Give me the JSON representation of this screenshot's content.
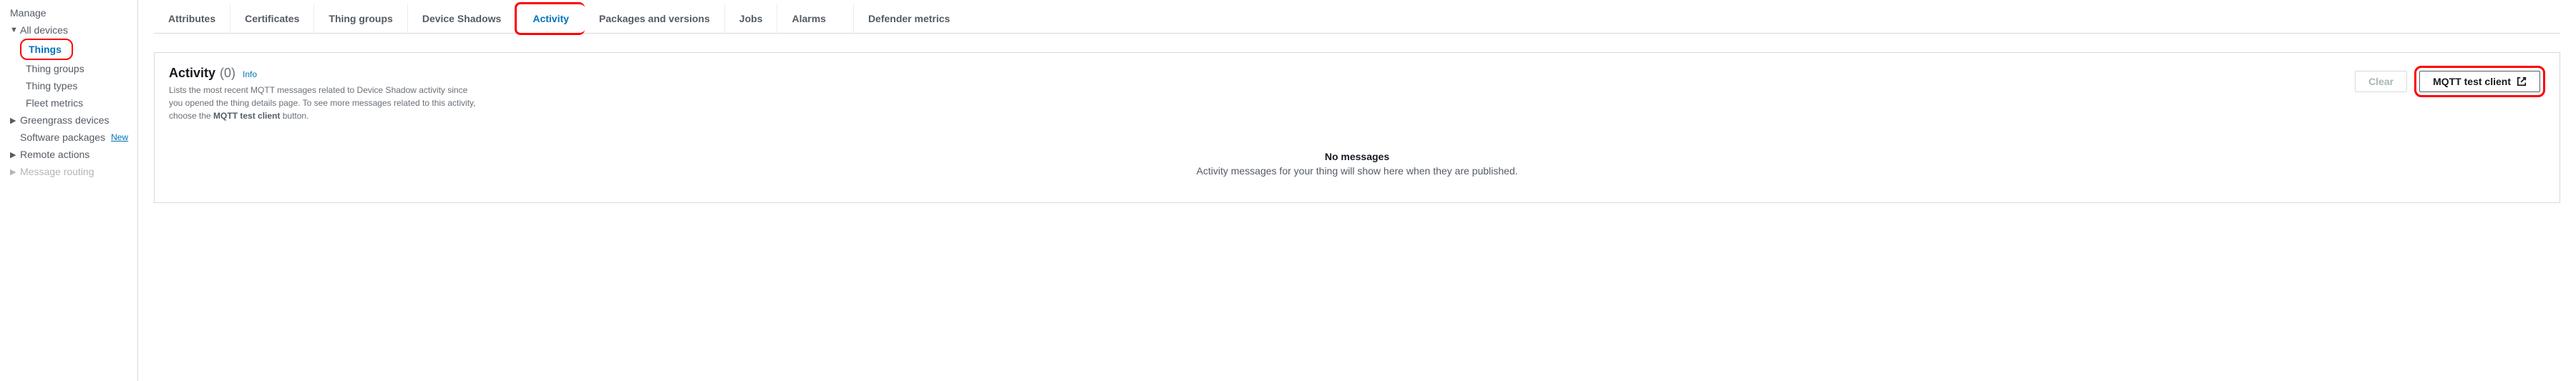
{
  "sidebar": {
    "manage_label": "Manage",
    "all_devices": {
      "label": "All devices",
      "items": [
        {
          "label": "Things",
          "active": true,
          "highlighted": true
        },
        {
          "label": "Thing groups"
        },
        {
          "label": "Thing types"
        },
        {
          "label": "Fleet metrics"
        }
      ]
    },
    "greengrass": {
      "label": "Greengrass devices"
    },
    "software_packages": {
      "label": "Software packages",
      "badge": "New"
    },
    "remote_actions": {
      "label": "Remote actions"
    },
    "message_routing": {
      "label": "Message routing"
    }
  },
  "tabs": [
    {
      "label": "Attributes"
    },
    {
      "label": "Certificates"
    },
    {
      "label": "Thing groups"
    },
    {
      "label": "Device Shadows"
    },
    {
      "label": "Activity",
      "active": true,
      "highlighted": true
    },
    {
      "label": "Packages and versions"
    },
    {
      "label": "Jobs"
    },
    {
      "label": "Alarms"
    },
    {
      "label": "Defender metrics",
      "gap_before": true
    }
  ],
  "panel": {
    "title": "Activity",
    "count": "(0)",
    "info_label": "Info",
    "description_prefix": "Lists the most recent MQTT messages related to Device Shadow activity since you opened the thing details page. To see more messages related to this activity, choose the ",
    "description_bold": "MQTT test client",
    "description_suffix": " button.",
    "actions": {
      "clear_label": "Clear",
      "mqtt_label": "MQTT test client"
    },
    "empty": {
      "title": "No messages",
      "description": "Activity messages for your thing will show here when they are published."
    }
  }
}
